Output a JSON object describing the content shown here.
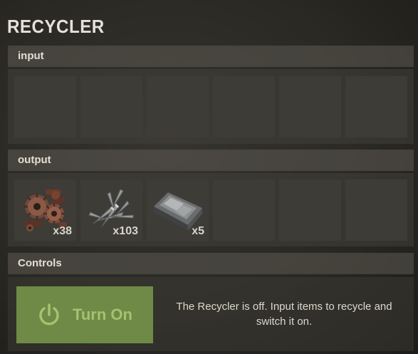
{
  "title": "RECYCLER",
  "input": {
    "header": "input",
    "slots": [
      {
        "empty": true
      },
      {
        "empty": true
      },
      {
        "empty": true
      },
      {
        "empty": true
      },
      {
        "empty": true
      },
      {
        "empty": true
      }
    ]
  },
  "output": {
    "header": "output",
    "slots": [
      {
        "item_icon": "gears-icon",
        "count": "x38"
      },
      {
        "item_icon": "metal-blade-icon",
        "count": "x103"
      },
      {
        "item_icon": "metal-fragments-icon",
        "count": "x5"
      },
      {
        "empty": true
      },
      {
        "empty": true
      },
      {
        "empty": true
      }
    ]
  },
  "controls": {
    "header": "Controls",
    "button_label": "Turn On",
    "button_icon": "power-icon",
    "button_color": "#6e8a46",
    "status_text": "The Recycler is off. Input items to recycle and switch it on."
  }
}
